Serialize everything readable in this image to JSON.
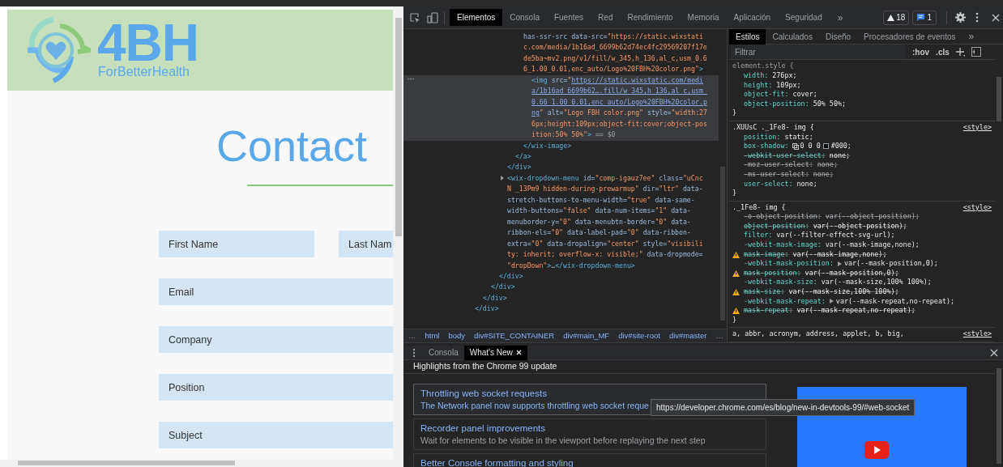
{
  "page": {
    "logo": {
      "mark": "4BH",
      "tagline": "ForBetterHealth"
    },
    "heading": "Contact",
    "fields": [
      {
        "placeholder": "First Name"
      },
      {
        "placeholder": "Last Nam"
      },
      {
        "placeholder": "Email"
      },
      {
        "placeholder": "Company"
      },
      {
        "placeholder": "Position"
      },
      {
        "placeholder": "Subject"
      }
    ]
  },
  "devtools": {
    "toolbar": {
      "tabs": [
        {
          "label": "Elementos",
          "selected": true
        },
        {
          "label": "Consola",
          "selected": false
        },
        {
          "label": "Fuentes",
          "selected": false
        },
        {
          "label": "Red",
          "selected": false
        },
        {
          "label": "Rendimiento",
          "selected": false
        },
        {
          "label": "Memoria",
          "selected": false
        },
        {
          "label": "Aplicación",
          "selected": false
        },
        {
          "label": "Seguridad",
          "selected": false
        }
      ],
      "more": "»",
      "warnings": "18",
      "issues": "1"
    },
    "elements": {
      "nodes": [
        {
          "selected": false,
          "close": [
            {
              "kind": "tag",
              "text": "</div>"
            }
          ],
          "children": [
            {
              "selected": false,
              "close": [
                {
                  "kind": "tag",
                  "text": "</div>"
                }
              ],
              "children": [
                {
                  "selected": false,
                  "close": [
                    {
                      "kind": "tag",
                      "text": "</div>"
                    }
                  ],
                  "children": [
                    {
                      "selected": false,
                      "close": [
                        {
                          "kind": "tag",
                          "text": "</div>"
                        }
                      ],
                      "children": [
                        {
                          "selected": false,
                          "close": [
                            {
                              "kind": "tag",
                              "text": "</div>"
                            }
                          ],
                          "children": [
                            {
                              "selected": false,
                              "close": [
                                {
                                  "kind": "tag",
                                  "text": "</a>"
                                }
                              ],
                              "children": [
                                {
                                  "selected": false,
                                  "open": [
                                    [
                                      {
                                        "kind": "attr",
                                        "text": "has-ssr-src data-src="
                                      },
                                      {
                                        "kind": "value",
                                        "text": "\"https://static.wixstati"
                                      }
                                    ],
                                    [
                                      {
                                        "kind": "value",
                                        "text": "c.com/media/1b16ad_6699b62d74ec4fc29569207f17e"
                                      }
                                    ],
                                    [
                                      {
                                        "kind": "value",
                                        "text": "de5ba~mv2.png/v1/fill/w_345,h_136,al_c,usm_0.6"
                                      }
                                    ],
                                    [
                                      {
                                        "kind": "value",
                                        "text": "6_1.00_0.01,enc_auto/Logo%20FBH%20color.png\""
                                      },
                                      {
                                        "kind": "tag",
                                        "text": ">"
                                      }
                                    ]
                                  ],
                                  "close": [
                                    {
                                      "kind": "tag",
                                      "text": "</wix-image>"
                                    }
                                  ],
                                  "children": [
                                    {
                                      "selected": true,
                                      "open": [
                                        [
                                          {
                                            "kind": "tag",
                                            "text": "<img"
                                          },
                                          {
                                            "kind": "attr",
                                            "text": " src="
                                          },
                                          {
                                            "kind": "value",
                                            "text": "\""
                                          },
                                          {
                                            "kind": "link",
                                            "text": "https://static.wixstatic.com/medi"
                                          }
                                        ],
                                        [
                                          {
                                            "kind": "link",
                                            "text": "a/1b16ad_6699b62….fill/w_345,h_136,al_c,usm_"
                                          }
                                        ],
                                        [
                                          {
                                            "kind": "link",
                                            "text": "0.66_1.00_0.01,enc_auto/Logo%20FBH%20color.p"
                                          }
                                        ],
                                        [
                                          {
                                            "kind": "link",
                                            "text": "ng"
                                          },
                                          {
                                            "kind": "value",
                                            "text": "\""
                                          },
                                          {
                                            "kind": "attr",
                                            "text": " alt="
                                          },
                                          {
                                            "kind": "value",
                                            "text": "\"Logo FBH color.png\""
                                          },
                                          {
                                            "kind": "attr",
                                            "text": " style="
                                          },
                                          {
                                            "kind": "value",
                                            "text": "\"width:27"
                                          }
                                        ],
                                        [
                                          {
                                            "kind": "value",
                                            "text": "6px;height:109px;object-fit:cover;object-pos"
                                          }
                                        ],
                                        [
                                          {
                                            "kind": "value",
                                            "text": "ition:50% 50%\""
                                          },
                                          {
                                            "kind": "tag",
                                            "text": ">"
                                          },
                                          {
                                            "kind": "ref",
                                            "text": " == $0"
                                          }
                                        ]
                                      ]
                                    }
                                  ]
                                }
                              ]
                            }
                          ]
                        },
                        {
                          "selected": false,
                          "expanded": false,
                          "open": [
                            [
                              {
                                "kind": "tag",
                                "text": "<wix-dropdown-menu"
                              },
                              {
                                "kind": "attr",
                                "text": " id="
                              },
                              {
                                "kind": "value",
                                "text": "\"comp-igauz7ee\""
                              },
                              {
                                "kind": "attr",
                                "text": " class="
                              },
                              {
                                "kind": "value",
                                "text": "\"uCnc"
                              }
                            ],
                            [
                              {
                                "kind": "value",
                                "text": "N _13Pm9 hidden-during-prewarmup\""
                              },
                              {
                                "kind": "attr",
                                "text": " dir="
                              },
                              {
                                "kind": "value",
                                "text": "\"ltr\""
                              },
                              {
                                "kind": "attr",
                                "text": " data-"
                              }
                            ],
                            [
                              {
                                "kind": "attr",
                                "text": "stretch-buttons-to-menu-width="
                              },
                              {
                                "kind": "value",
                                "text": "\"true\""
                              },
                              {
                                "kind": "attr",
                                "text": " data-same-"
                              }
                            ],
                            [
                              {
                                "kind": "attr",
                                "text": "width-buttons="
                              },
                              {
                                "kind": "value",
                                "text": "\"false\""
                              },
                              {
                                "kind": "attr",
                                "text": " data-num-items="
                              },
                              {
                                "kind": "value",
                                "text": "\"1\""
                              },
                              {
                                "kind": "attr",
                                "text": " data-"
                              }
                            ],
                            [
                              {
                                "kind": "attr",
                                "text": "menuborder-y="
                              },
                              {
                                "kind": "value",
                                "text": "\"0\""
                              },
                              {
                                "kind": "attr",
                                "text": " data-menubtn-border="
                              },
                              {
                                "kind": "value",
                                "text": "\"0\""
                              },
                              {
                                "kind": "attr",
                                "text": " data-"
                              }
                            ],
                            [
                              {
                                "kind": "attr",
                                "text": "ribbon-els="
                              },
                              {
                                "kind": "value",
                                "text": "\"0\""
                              },
                              {
                                "kind": "attr",
                                "text": " data-label-pad="
                              },
                              {
                                "kind": "value",
                                "text": "\"0\""
                              },
                              {
                                "kind": "attr",
                                "text": " data-ribbon-"
                              }
                            ],
                            [
                              {
                                "kind": "attr",
                                "text": "extra="
                              },
                              {
                                "kind": "value",
                                "text": "\"0\""
                              },
                              {
                                "kind": "attr",
                                "text": " data-dropalign="
                              },
                              {
                                "kind": "value",
                                "text": "\"center\""
                              },
                              {
                                "kind": "attr",
                                "text": " style="
                              },
                              {
                                "kind": "value",
                                "text": "\"visibili"
                              }
                            ],
                            [
                              {
                                "kind": "value",
                                "text": "ty: inherit; overflow-x: visible;\""
                              },
                              {
                                "kind": "attr",
                                "text": " data-dropmode="
                              }
                            ],
                            [
                              {
                                "kind": "value",
                                "text": "\"dropDown\""
                              },
                              {
                                "kind": "tag",
                                "text": ">"
                              },
                              {
                                "kind": "plain",
                                "text": "…"
                              },
                              {
                                "kind": "tag",
                                "text": "</wix-dropdown-menu>"
                              }
                            ]
                          ]
                        }
                      ]
                    }
                  ]
                }
              ]
            }
          ]
        }
      ]
    },
    "breadcrumb": {
      "start": "…",
      "items": [
        "html",
        "body",
        "div#SITE_CONTAINER",
        "div#main_MF",
        "div#site-root",
        "div#master"
      ],
      "end": "…"
    },
    "styles": {
      "tabs": [
        {
          "label": "Estilos",
          "selected": true
        },
        {
          "label": "Calculados",
          "selected": false
        },
        {
          "label": "Diseño",
          "selected": false
        },
        {
          "label": "Procesadores de eventos",
          "selected": false
        }
      ],
      "more": "»",
      "filter": {
        "placeholder": "Filtrar"
      },
      "hov": ":hov",
      "cls": ".cls",
      "rules": [
        {
          "selector": "element.style {",
          "close": "}",
          "properties": [
            {
              "kind": "plain",
              "name": "width:",
              "value": "276px;",
              "struck": false,
              "inactive": false,
              "warning": false
            },
            {
              "kind": "plain",
              "name": "height:",
              "value": "109px;",
              "struck": false,
              "inactive": false,
              "warning": false
            },
            {
              "kind": "plain",
              "name": "object-fit:",
              "value": "cover;",
              "struck": false,
              "inactive": false,
              "warning": false
            },
            {
              "kind": "plain",
              "name": "object-position:",
              "value": "50% 50%;",
              "struck": false,
              "inactive": false,
              "warning": false
            }
          ]
        },
        {
          "selector": ".XUUsC ._1Fe8- img {",
          "source": "<style>",
          "close": "}",
          "properties": [
            {
              "kind": "plain",
              "name": "position:",
              "value": "static;",
              "struck": false,
              "inactive": false,
              "warning": false
            },
            {
              "kind": "shadow",
              "name": "box-shadow:",
              "value": "0 0 0",
              "swatch": "#000;",
              "color": "#000000",
              "struck": false,
              "inactive": false,
              "warning": false
            },
            {
              "kind": "plain",
              "name": "-webkit-user-select:",
              "value": "none;",
              "struck": true,
              "inactive": false,
              "warning": false
            },
            {
              "kind": "plain",
              "name": "-moz-user-select:",
              "value": "none;",
              "struck": true,
              "inactive": true,
              "warning": false
            },
            {
              "kind": "plain",
              "name": "-ms-user-select:",
              "value": "none;",
              "struck": true,
              "inactive": true,
              "warning": false
            },
            {
              "kind": "plain",
              "name": "user-select:",
              "value": "none;",
              "struck": false,
              "inactive": false,
              "warning": false
            }
          ]
        },
        {
          "selector": "._1Fe8- img {",
          "source": "<style>",
          "close": "}",
          "properties": [
            {
              "kind": "plain",
              "name": "-o-object-position:",
              "value": "var(--object-position);",
              "struck": true,
              "inactive": true,
              "warning": false
            },
            {
              "kind": "plain",
              "name": "object-position:",
              "value": "var(--object-position);",
              "struck": true,
              "inactive": false,
              "warning": false
            },
            {
              "kind": "plain",
              "name": "filter:",
              "value": "var(--filter-effect-svg-url);",
              "struck": false,
              "inactive": false,
              "warning": false
            },
            {
              "kind": "plain",
              "name": "-webkit-mask-image:",
              "value": "var(--mask-image,none);",
              "struck": false,
              "inactive": false,
              "warning": false
            },
            {
              "kind": "plain",
              "name": "mask-image:",
              "value": "var(--mask-image,none);",
              "struck": true,
              "inactive": false,
              "warning": true
            },
            {
              "kind": "expandable",
              "name": "-webkit-mask-position:",
              "value": "var(--mask-position,0);",
              "struck": false,
              "inactive": false,
              "warning": false
            },
            {
              "kind": "plain",
              "name": "mask-position:",
              "value": "var(--mask-position,0);",
              "struck": true,
              "inactive": false,
              "warning": true
            },
            {
              "kind": "plain",
              "name": "-webkit-mask-size:",
              "value": "var(--mask-size,100% 100%);",
              "struck": false,
              "inactive": false,
              "warning": false
            },
            {
              "kind": "plain",
              "name": "mask-size:",
              "value": "var(--mask-size,100% 100%);",
              "struck": true,
              "inactive": false,
              "warning": true
            },
            {
              "kind": "expandable",
              "name": "-webkit-mask-repeat:",
              "value": "var(--mask-repeat,no-repeat);",
              "struck": false,
              "inactive": false,
              "warning": false
            },
            {
              "kind": "plain",
              "name": "mask-repeat:",
              "value": "var(--mask-repeat,no-repeat);",
              "struck": true,
              "inactive": false,
              "warning": true
            }
          ]
        },
        {
          "selector": "a, abbr, acronym, address, applet, b, big,",
          "source": "<style>"
        }
      ]
    },
    "drawer": {
      "tabs": [
        {
          "label": "Consola",
          "selected": false,
          "closable": false
        },
        {
          "label": "What's New",
          "selected": true,
          "closable": true
        }
      ],
      "heading": "Highlights from the Chrome 99 update",
      "cards": [
        {
          "title": "Throttling web socket requests",
          "description": "The Network panel now supports throttling web socket reque",
          "hovered": true
        },
        {
          "title": "Recorder panel improvements",
          "description": "Wait for elements to be visible in the viewport before replaying the next step",
          "hovered": false
        },
        {
          "title": "Better Console formatting and styling",
          "hovered": false
        }
      ],
      "tooltip": "https://developer.chrome.com/es/blog/new-in-devtools-99/#web-socket"
    }
  }
}
